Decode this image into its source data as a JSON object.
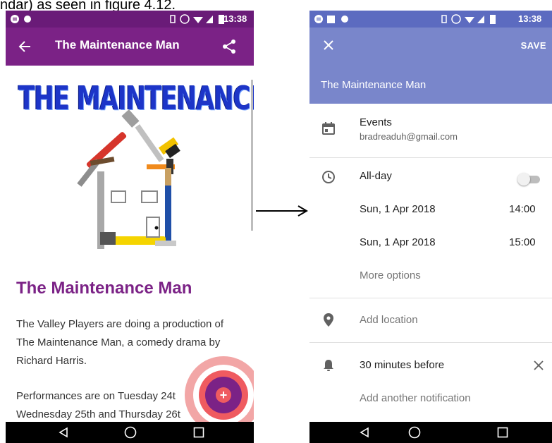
{
  "caption": "ndar) as seen in figure 4.12.",
  "left_phone": {
    "status_bar": {
      "time": "13:38"
    },
    "app_bar": {
      "title": "The Maintenance Man"
    },
    "logo_text": "THE MAINTENANCE MAN",
    "article": {
      "title": "The Maintenance Man",
      "paragraph_lines": [
        "The Valley Players are doing a production of",
        "The Maintenance Man, a comedy drama by",
        "Richard Harris."
      ],
      "paragraph2_lines": [
        "Performances are on Tuesday 24t",
        "Wednesday 25th and Thursday 26t"
      ]
    },
    "fab_symbol": "+"
  },
  "right_phone": {
    "status_bar": {
      "time": "13:38"
    },
    "header": {
      "save_label": "SAVE",
      "event_title": "The Maintenance Man"
    },
    "calendar": {
      "name": "Events",
      "account": "bradreaduh@gmail.com"
    },
    "all_day": {
      "label": "All-day",
      "enabled": false
    },
    "start": {
      "date": "Sun, 1 Apr 2018",
      "time": "14:00"
    },
    "end": {
      "date": "Sun, 1 Apr 2018",
      "time": "15:00"
    },
    "more_options": "More options",
    "location_placeholder": "Add location",
    "notification": {
      "label": "30 minutes before"
    },
    "add_notification": "Add another notification"
  },
  "colors": {
    "purple_accent": "#7b2286",
    "indigo_header": "#7986cb",
    "fab_ring": "#ef5b60"
  }
}
